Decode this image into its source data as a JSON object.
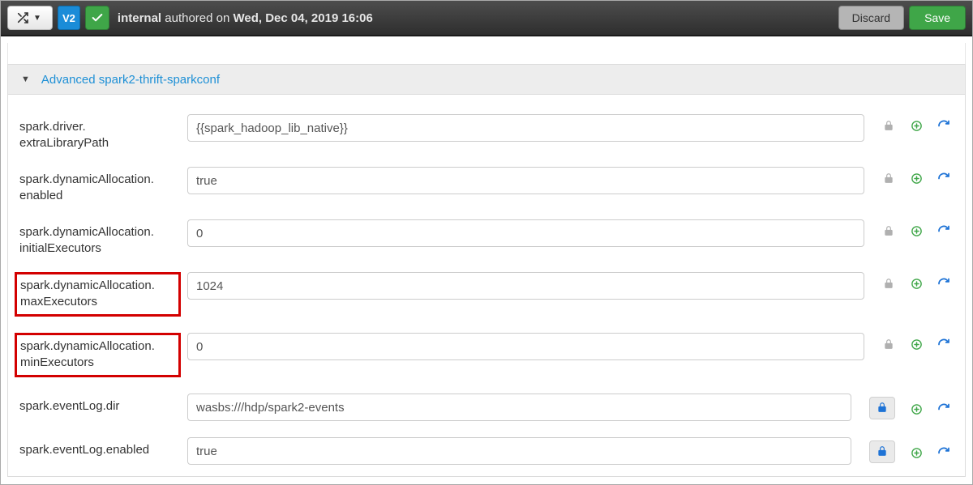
{
  "topbar": {
    "version_badge": "V2",
    "author_prefix_bold": "internal",
    "author_mid": " authored on ",
    "author_date_bold": "Wed, Dec 04, 2019 16:06",
    "discard": "Discard",
    "save": "Save"
  },
  "panel": {
    "title": "Advanced spark2-thrift-sparkconf"
  },
  "rows": [
    {
      "label": "spark.driver.\nextraLibraryPath",
      "value": "{{spark_hadoop_lib_native}}",
      "highlight": false,
      "locked": false
    },
    {
      "label": "spark.dynamicAllocation.\nenabled",
      "value": "true",
      "highlight": false,
      "locked": false
    },
    {
      "label": "spark.dynamicAllocation.\ninitialExecutors",
      "value": "0",
      "highlight": false,
      "locked": false
    },
    {
      "label": "spark.dynamicAllocation.\nmaxExecutors",
      "value": "1024",
      "highlight": true,
      "locked": false
    },
    {
      "label": "spark.dynamicAllocation.\nminExecutors",
      "value": "0",
      "highlight": true,
      "locked": false
    },
    {
      "label": "spark.eventLog.dir",
      "value": "wasbs:///hdp/spark2-events",
      "highlight": false,
      "locked": true
    },
    {
      "label": "spark.eventLog.enabled",
      "value": "true",
      "highlight": false,
      "locked": true
    }
  ]
}
